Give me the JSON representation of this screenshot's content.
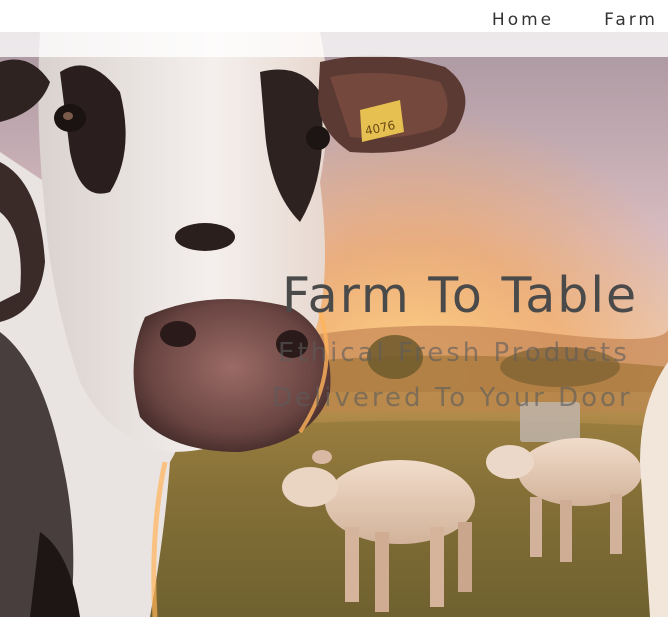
{
  "nav": {
    "items": [
      {
        "label": "Home"
      },
      {
        "label": "Farm"
      }
    ]
  },
  "hero": {
    "title": "Farm To Table",
    "subtitle_line1": "Ethical Fresh Products",
    "subtitle_line2": "Delivered To Your Door",
    "ear_tag": "4076"
  },
  "colors": {
    "nav_text": "#333333",
    "title_text": "#4a4a4a",
    "subtitle_text": "#5c5c5c",
    "sky_top": "#b7a4a9",
    "sky_horizon": "#f1cfa2",
    "sun_glow": "#f3a646",
    "grass": "#7d6a36"
  }
}
